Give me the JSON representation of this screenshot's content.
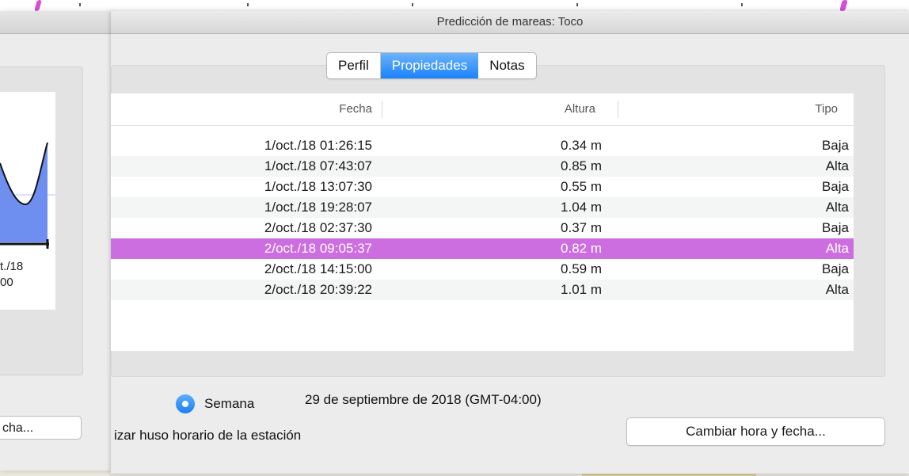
{
  "main_window": {
    "title": "Predicción de mareas: Toco",
    "tabs": [
      {
        "label": "Perfil",
        "active": false
      },
      {
        "label": "Propiedades",
        "active": true
      },
      {
        "label": "Notas",
        "active": false
      }
    ],
    "table": {
      "columns": [
        "Fecha",
        "Altura",
        "Tipo"
      ],
      "rows": [
        {
          "fecha": "1/oct./18 01:26:15",
          "altura": "0.34 m",
          "tipo": "Baja",
          "selected": false
        },
        {
          "fecha": "1/oct./18 07:43:07",
          "altura": "0.85 m",
          "tipo": "Alta",
          "selected": false
        },
        {
          "fecha": "1/oct./18 13:07:30",
          "altura": "0.55 m",
          "tipo": "Baja",
          "selected": false
        },
        {
          "fecha": "1/oct./18 19:28:07",
          "altura": "1.04 m",
          "tipo": "Alta",
          "selected": false
        },
        {
          "fecha": "2/oct./18 02:37:30",
          "altura": "0.37 m",
          "tipo": "Baja",
          "selected": false
        },
        {
          "fecha": "2/oct./18 09:05:37",
          "altura": "0.82 m",
          "tipo": "Alta",
          "selected": true
        },
        {
          "fecha": "2/oct./18 14:15:00",
          "altura": "0.59 m",
          "tipo": "Baja",
          "selected": false
        },
        {
          "fecha": "2/oct./18 20:39:22",
          "altura": "1.01 m",
          "tipo": "Alta",
          "selected": false
        }
      ]
    },
    "radio_label": "Semana",
    "date_text": "29 de septiembre de 2018 (GMT-04:00)",
    "timezone_checkbox_text": "izar huso horario de la estación",
    "change_button": "Cambiar hora y fecha..."
  },
  "back_window": {
    "chart_label_1": "t./18",
    "chart_label_2": "00",
    "button": "cha..."
  },
  "colors": {
    "selection": "#cc6ee0",
    "accent": "#1a82fb",
    "chart_fill": "#6e8ff0"
  }
}
